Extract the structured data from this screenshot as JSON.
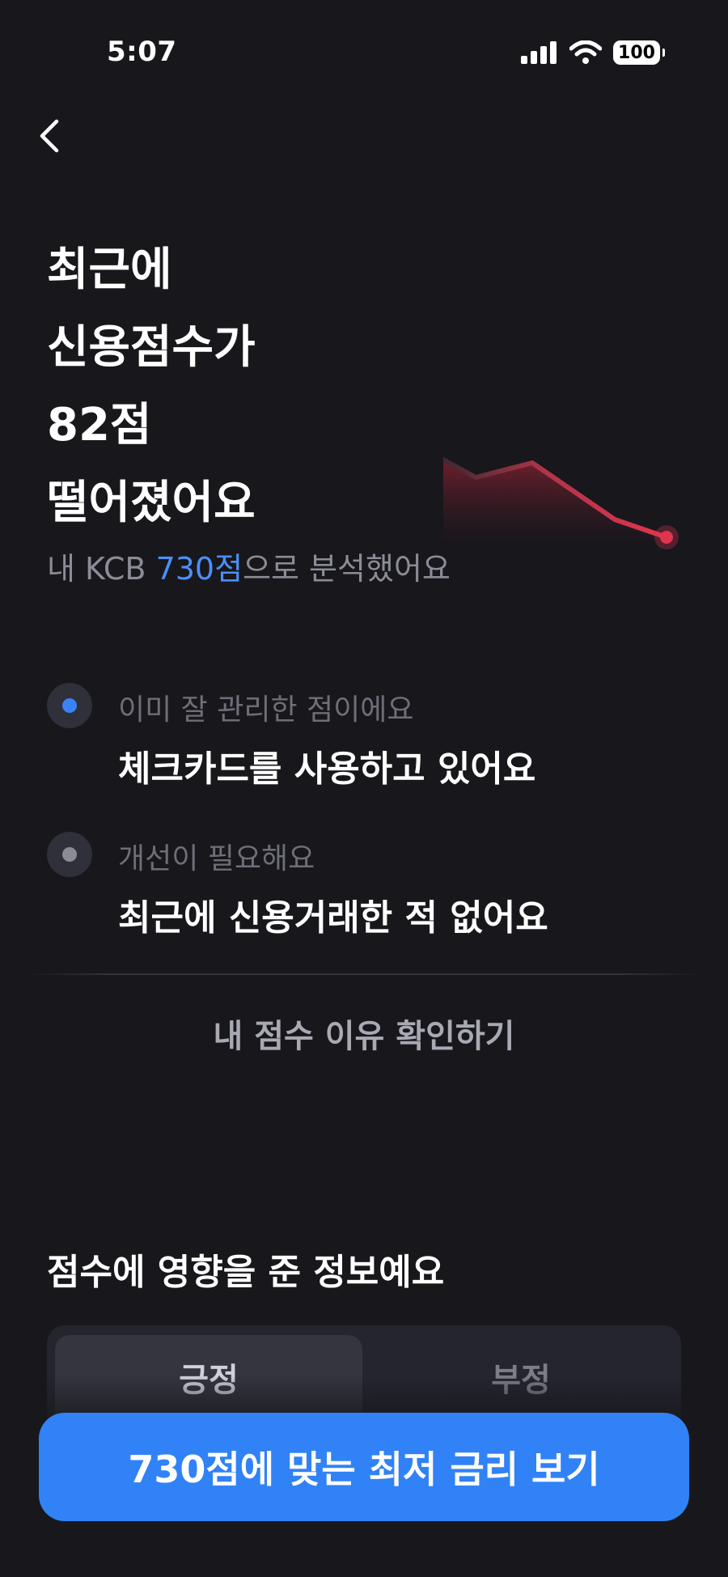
{
  "status_bar": {
    "time": "5:07",
    "battery": "100"
  },
  "headline": {
    "lines": [
      "최근에",
      "신용점수가",
      "82점",
      "떨어졌어요"
    ]
  },
  "subtitle": {
    "prefix": "내 KCB ",
    "score": "730점",
    "suffix": "으로 분석했어요"
  },
  "reasons": [
    {
      "label": "이미 잘 관리한 점이에요",
      "text": "체크카드를 사용하고 있어요",
      "dot_color": "#3b82f6"
    },
    {
      "label": "개선이 필요해요",
      "text": "최근에 신용거래한 적 없어요",
      "dot_color": "#8a8b94"
    }
  ],
  "reason_link": "내 점수 이유 확인하기",
  "section_title": "점수에 영향을 준 정보예요",
  "tabs": {
    "positive": "긍정",
    "negative": "부정"
  },
  "cta": "730점에 맞는 최저 금리 보기",
  "colors": {
    "accent": "#3182f6",
    "decline": "#e0354f",
    "background": "#17171c"
  },
  "icons": {
    "back": "chevron-left-icon",
    "signal": "cellular-signal-icon",
    "wifi": "wifi-icon",
    "battery": "battery-icon"
  }
}
